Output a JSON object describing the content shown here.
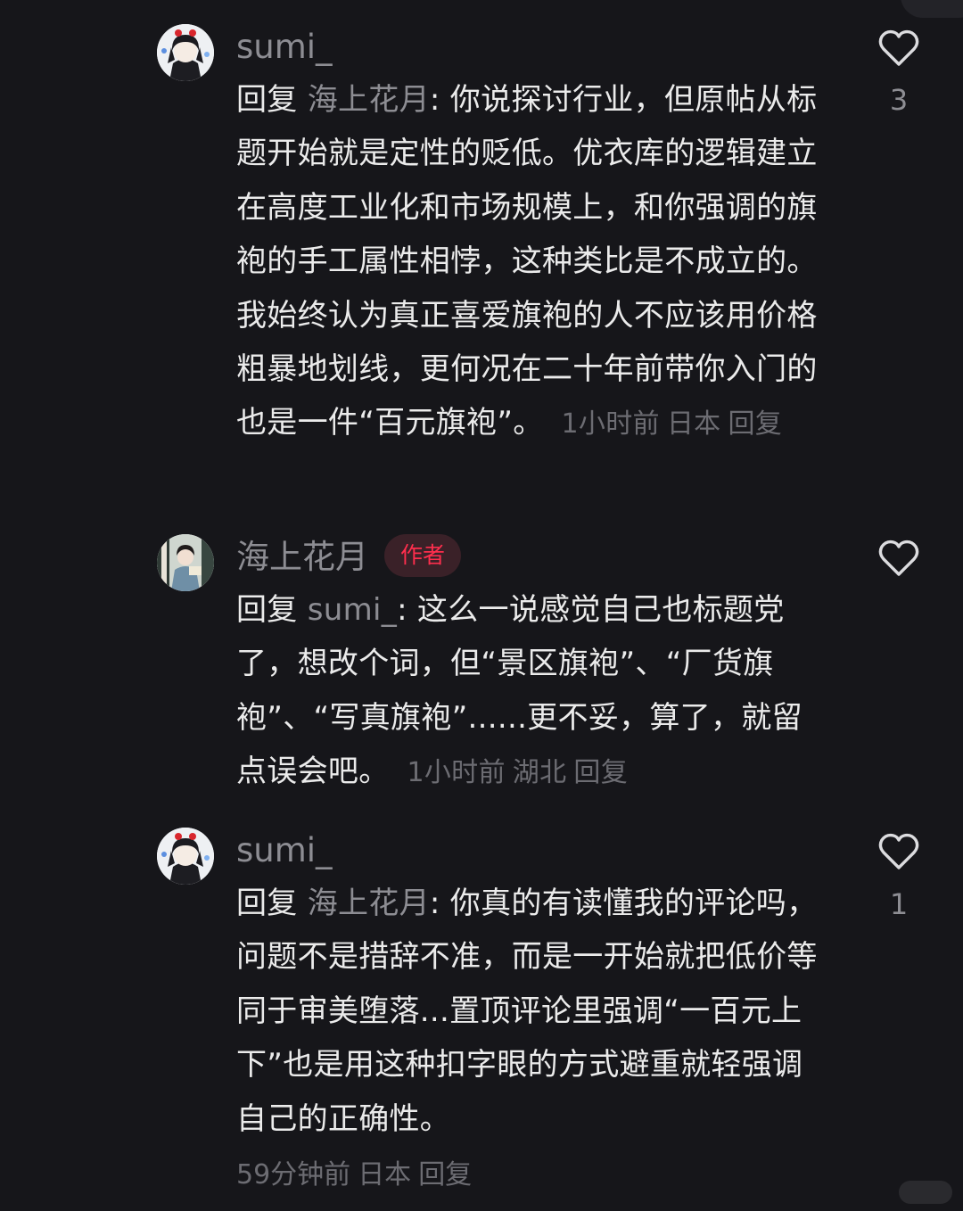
{
  "comments": [
    {
      "username": "sumi_",
      "reply_prefix": "回复 ",
      "reply_target": "海上花月",
      "text": ": 你说探讨行业，但原帖从标题开始就是定性的贬低。优衣库的逻辑建立在高度工业化和市场规模上，和你强调的旗袍的手工属性相悖，这种类比是不成立的。我始终认为真正喜爱旗袍的人不应该用价格粗暴地划线，更何况在二十年前带你入门的也是一件“百元旗袍”。",
      "time": "1小时前",
      "location": "日本",
      "reply_label": "回复",
      "like_count": "3",
      "like_icon": "heart-outline-icon"
    },
    {
      "username": "海上花月",
      "badge": "作者",
      "reply_prefix": "回复 ",
      "reply_target": "sumi_",
      "text": ": 这么一说感觉自己也标题党了，想改个词，但“景区旗袍”、“厂货旗袍”、“写真旗袍”......更不妥，算了，就留点误会吧。",
      "time": "1小时前",
      "location": "湖北",
      "reply_label": "回复",
      "like_count": "",
      "like_icon": "heart-outline-icon"
    },
    {
      "username": "sumi_",
      "reply_prefix": "回复 ",
      "reply_target": "海上花月",
      "text": ": 你真的有读懂我的评论吗，问题不是措辞不准，而是一开始就把低价等同于审美堕落...置顶评论里强调“一百元上下”也是用这种扣字眼的方式避重就轻强调自己的正确性。",
      "time": "59分钟前",
      "location": "日本",
      "reply_label": "回复",
      "like_count": "1",
      "like_icon": "heart-outline-icon"
    }
  ],
  "colors": {
    "background": "#16161a",
    "text": "#ebebeb",
    "muted": "#8d8d93",
    "meta": "#6c6c72",
    "author_badge_text": "#ff2e4d",
    "author_badge_bg": "#3a2128"
  }
}
